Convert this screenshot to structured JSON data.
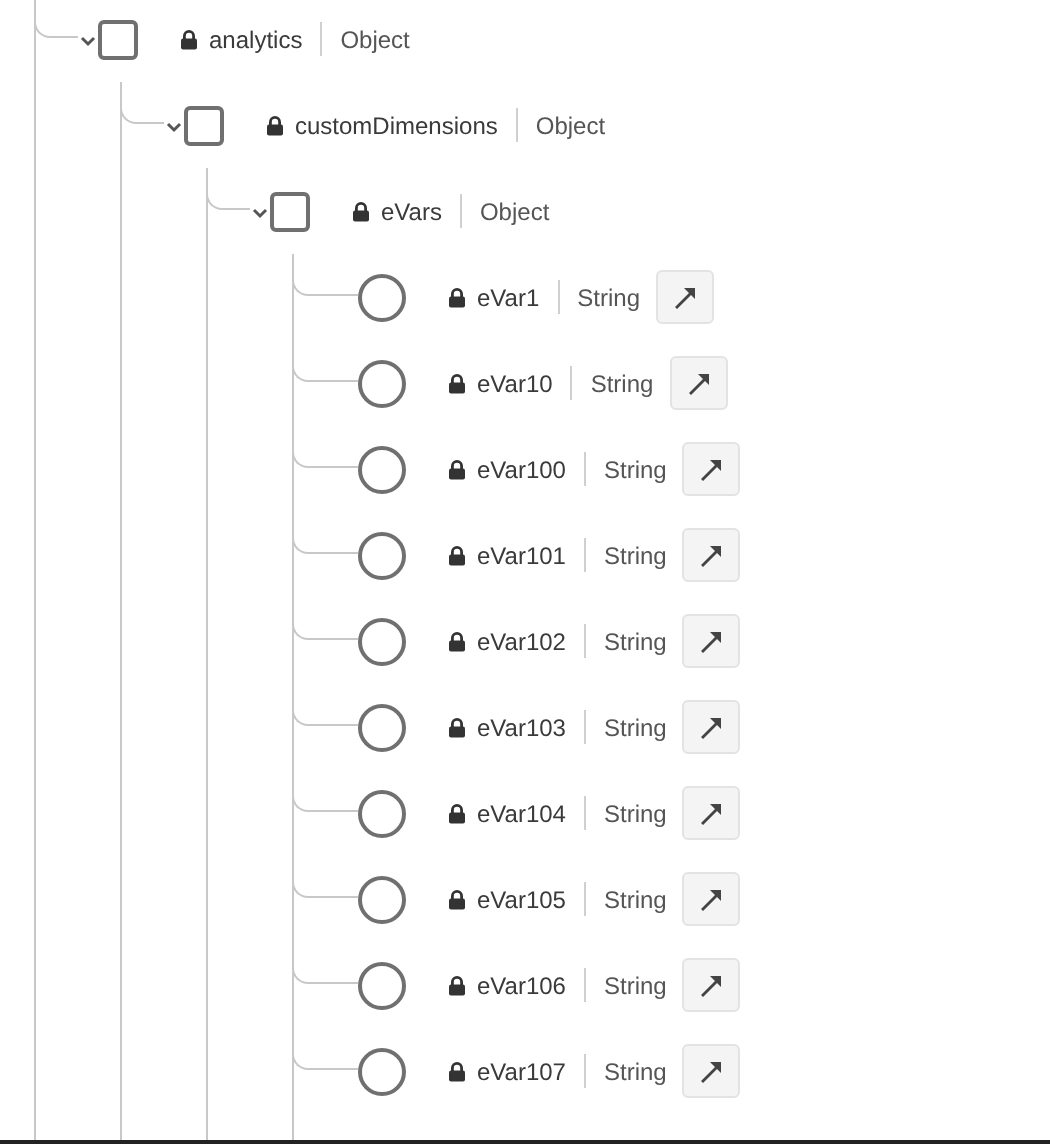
{
  "tree": [
    {
      "kind": "object",
      "name": "analytics",
      "type": "Object",
      "locked": true,
      "selected": false,
      "expanded": true,
      "children": [
        {
          "kind": "object",
          "name": "customDimensions",
          "type": "Object",
          "locked": true,
          "selected": false,
          "expanded": true,
          "children": [
            {
              "kind": "object",
              "name": "eVars",
              "type": "Object",
              "locked": true,
              "selected": false,
              "expanded": true,
              "children": [
                {
                  "kind": "field",
                  "name": "eVar1",
                  "type": "String",
                  "locked": true,
                  "selected": false
                },
                {
                  "kind": "field",
                  "name": "eVar10",
                  "type": "String",
                  "locked": true,
                  "selected": false
                },
                {
                  "kind": "field",
                  "name": "eVar100",
                  "type": "String",
                  "locked": true,
                  "selected": false
                },
                {
                  "kind": "field",
                  "name": "eVar101",
                  "type": "String",
                  "locked": true,
                  "selected": false
                },
                {
                  "kind": "field",
                  "name": "eVar102",
                  "type": "String",
                  "locked": true,
                  "selected": false
                },
                {
                  "kind": "field",
                  "name": "eVar103",
                  "type": "String",
                  "locked": true,
                  "selected": false
                },
                {
                  "kind": "field",
                  "name": "eVar104",
                  "type": "String",
                  "locked": true,
                  "selected": false
                },
                {
                  "kind": "field",
                  "name": "eVar105",
                  "type": "String",
                  "locked": true,
                  "selected": false
                },
                {
                  "kind": "field",
                  "name": "eVar106",
                  "type": "String",
                  "locked": true,
                  "selected": false
                },
                {
                  "kind": "field",
                  "name": "eVar107",
                  "type": "String",
                  "locked": true,
                  "selected": false
                }
              ]
            }
          ]
        }
      ]
    }
  ]
}
